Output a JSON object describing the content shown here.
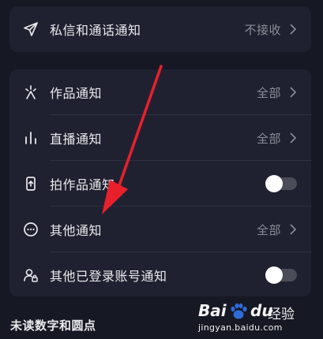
{
  "colors": {
    "background": "#161823",
    "card": "#1f2130",
    "arrow": "#e8202c"
  },
  "card1": {
    "rows": [
      {
        "icon": "send-icon",
        "label": "私信和通话通知",
        "value": "不接收"
      }
    ]
  },
  "card2": {
    "rows": [
      {
        "icon": "sparkle-icon",
        "label": "作品通知",
        "value": "全部"
      },
      {
        "icon": "bar-chart-icon",
        "label": "直播通知",
        "value": "全部"
      },
      {
        "icon": "phone-upload-icon",
        "label": "拍作品通知",
        "toggle_on": false
      },
      {
        "icon": "more-circle-icon",
        "label": "其他通知",
        "value": "全部"
      },
      {
        "icon": "user-lock-icon",
        "label": "其他已登录账号通知",
        "toggle_on": false
      }
    ]
  },
  "section": {
    "title": "未读数字和圆点"
  },
  "watermark": {
    "logo_left": "Bai",
    "logo_right": "du",
    "brand_text": "经验",
    "url": "jingyan.baidu.com"
  }
}
